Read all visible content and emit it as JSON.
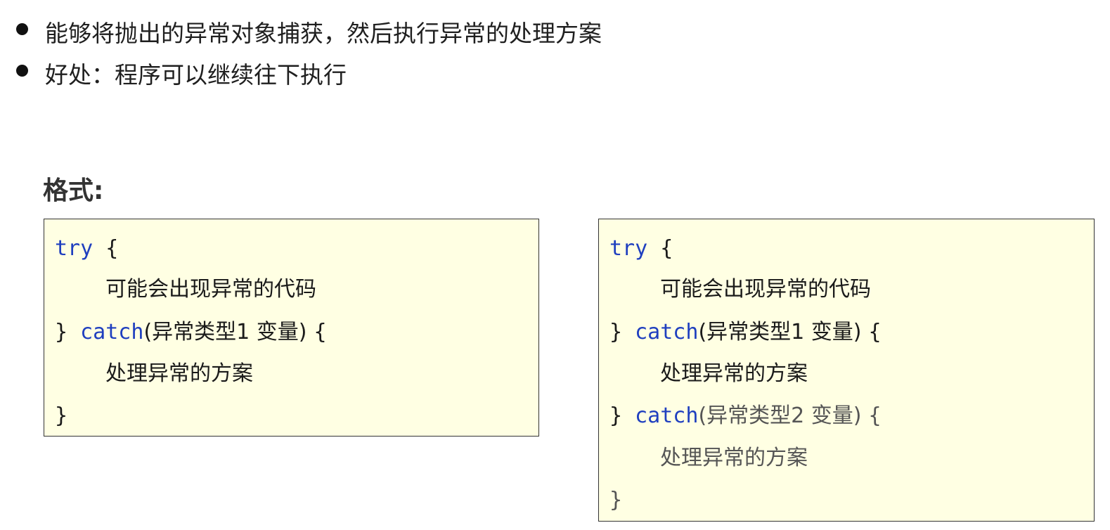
{
  "bullets": [
    "能够将抛出的异常对象捕获，然后执行异常的处理方案",
    "好处：程序可以继续往下执行"
  ],
  "format_label": "格式:",
  "colors": {
    "code_bg": "#ffffe3",
    "keyword": "#1f3fbf",
    "text": "#1a1a1a"
  },
  "code_left": {
    "try_kw": "try",
    "brace_open": " {",
    "body1": "可能会出现异常的代码",
    "close_brace": "} ",
    "catch_kw": "catch",
    "catch1_args": "(异常类型1  变量) {",
    "handler1": "处理异常的方案",
    "end_brace": "}"
  },
  "code_right": {
    "try_kw": "try",
    "brace_open": " {",
    "body1": "可能会出现异常的代码",
    "close_brace": "} ",
    "catch_kw": "catch",
    "catch1_args": "(异常类型1  变量) {",
    "handler1": "处理异常的方案",
    "close_brace2": "} ",
    "catch_kw2": "catch",
    "catch2_args": "(异常类型2  变量) {",
    "handler2": "处理异常的方案",
    "end_brace": "}"
  }
}
